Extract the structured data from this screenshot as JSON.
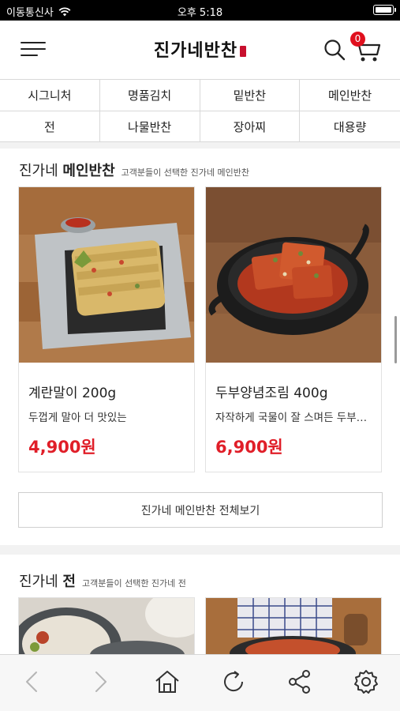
{
  "status_bar": {
    "carrier": "이동통신사",
    "time": "오후 5:18"
  },
  "header": {
    "logo": "진가네반찬",
    "cart_count": "0"
  },
  "categories": [
    "시그니처",
    "명품김치",
    "밑반찬",
    "메인반찬",
    "전",
    "나물반찬",
    "장아찌",
    "대용량"
  ],
  "section_main": {
    "title_prefix": "진가네",
    "title_bold": "메인반찬",
    "subtitle": "고객분들이 선택한 진가네 메인반찬",
    "products": [
      {
        "name": "계란말이 200g",
        "desc": "두껍게 말아 더 맛있는",
        "price": "4,900원"
      },
      {
        "name": "두부양념조림 400g",
        "desc": "자작하게 국물이 잘 스며든 두부…",
        "price": "6,900원"
      }
    ],
    "view_all": "진가네 메인반찬 전체보기"
  },
  "section_jeon": {
    "title_prefix": "진가네",
    "title_bold": "전",
    "subtitle": "고객분들이 선택한 진가네 전"
  },
  "toolbar": {
    "icons": [
      "back-icon",
      "forward-icon",
      "home-icon",
      "refresh-icon",
      "share-icon",
      "settings-icon"
    ]
  },
  "colors": {
    "accent": "#e01e28",
    "badge": "#e0101e"
  }
}
